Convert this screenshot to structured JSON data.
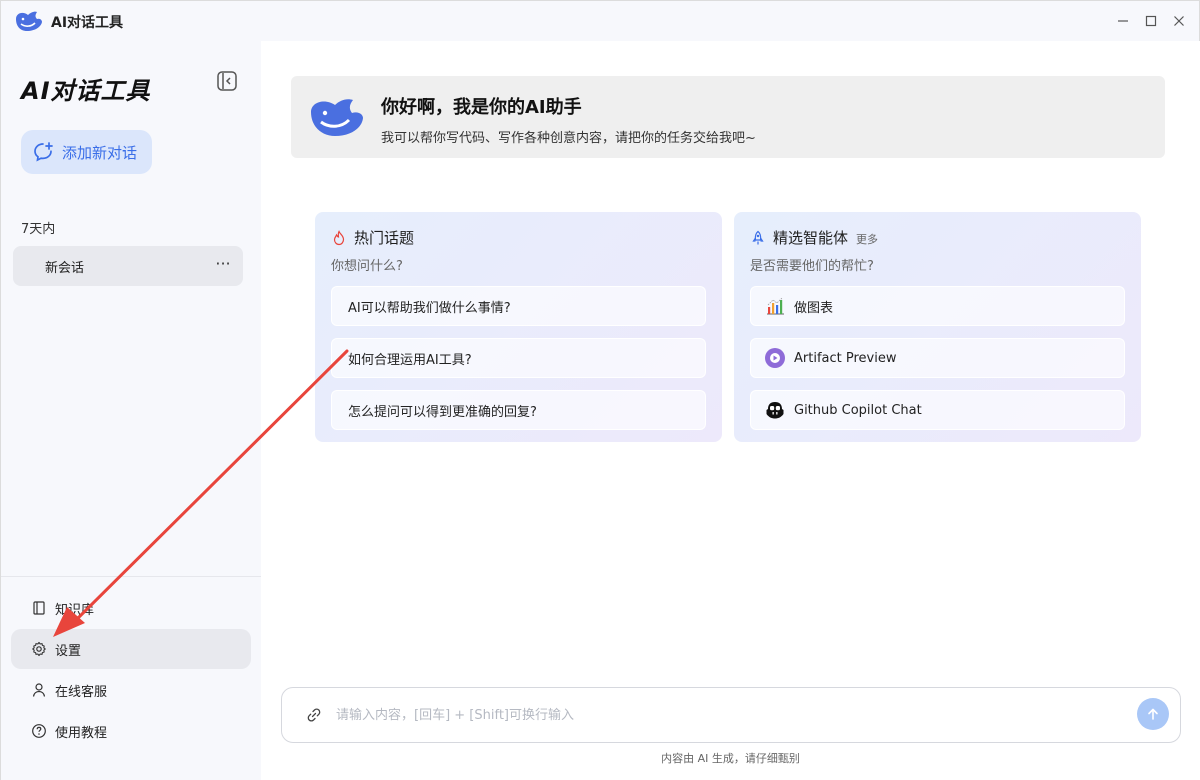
{
  "window": {
    "title": "AI对话工具",
    "controls": [
      "minimize-icon",
      "maximize-icon",
      "close-icon"
    ]
  },
  "sidebar": {
    "brand": "AI对话工具",
    "new_chat_label": "添加新对话",
    "section_label": "7天内",
    "conversations": [
      {
        "label": "新会话",
        "more": "···"
      }
    ],
    "nav": [
      {
        "label": "知识库",
        "icon": "book-icon"
      },
      {
        "label": "设置",
        "icon": "gear-icon",
        "active": true
      },
      {
        "label": "在线客服",
        "icon": "user-icon"
      },
      {
        "label": "使用教程",
        "icon": "help-circle-icon"
      }
    ]
  },
  "welcome": {
    "title": "你好啊，我是你的AI助手",
    "subtitle": "我可以帮你写代码、写作各种创意内容，请把你的任务交给我吧~"
  },
  "hot_topics": {
    "title": "热门话题",
    "subtitle": "你想问什么?",
    "items": [
      "AI可以帮助我们做什么事情?",
      "如何合理运用AI工具?",
      "怎么提问可以得到更准确的回复?"
    ]
  },
  "agents": {
    "title": "精选智能体",
    "more": "更多",
    "subtitle": "是否需要他们的帮忙?",
    "items": [
      {
        "label": "做图表",
        "icon": "chart-icon"
      },
      {
        "label": "Artifact Preview",
        "icon": "artifact-icon"
      },
      {
        "label": "Github Copilot Chat",
        "icon": "copilot-icon"
      }
    ]
  },
  "input": {
    "placeholder": "请输入内容，[回车] + [Shift]可换行输入",
    "value": ""
  },
  "footnote": "内容由 AI 生成，请仔细甄别",
  "colors": {
    "accent": "#3a6ee8",
    "annotation_arrow": "#e8453c"
  }
}
